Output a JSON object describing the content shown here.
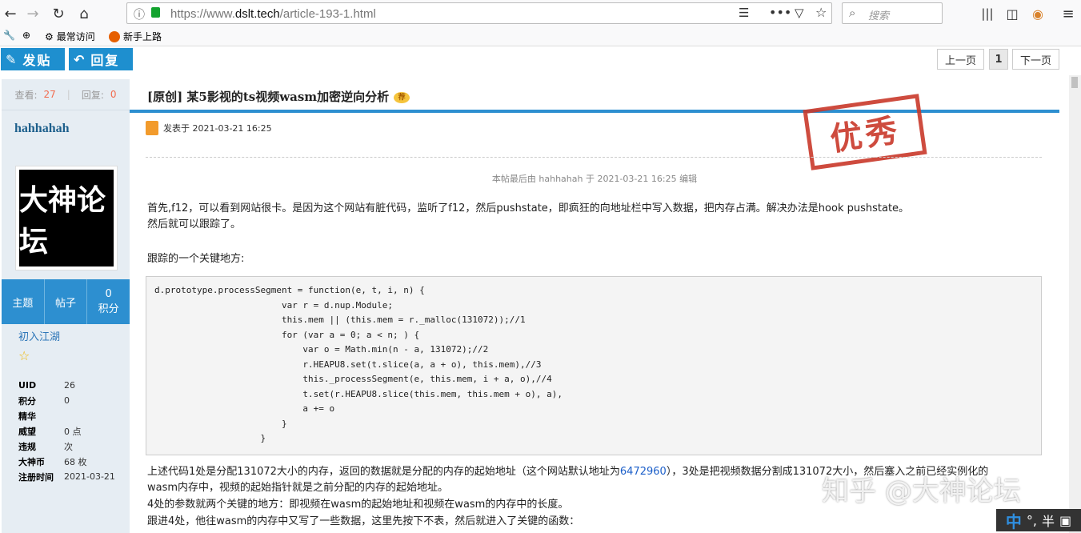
{
  "browser": {
    "url_prefix": "https://www.",
    "url_host": "dslt.tech",
    "url_path": "/article-193-1.html",
    "search_placeholder": "搜索",
    "bookmarks": [
      "最常访问",
      "新手上路"
    ]
  },
  "actions": {
    "post_label": "发贴",
    "reply_label": "回复"
  },
  "pager": {
    "prev": "上一页",
    "current": "1",
    "next": "下一页"
  },
  "sidebar": {
    "views_label": "查看:",
    "views_value": "27",
    "replies_label": "回复:",
    "replies_value": "0",
    "author": "hahhahah",
    "avatar_text": "大神论坛",
    "stat_cells": [
      "主题",
      "帖子",
      "0",
      "积分"
    ],
    "level": "初入江湖",
    "info": [
      {
        "k": "UID",
        "v": "26"
      },
      {
        "k": "积分",
        "v": "0"
      },
      {
        "k": "精华",
        "v": ""
      },
      {
        "k": "威望",
        "v": "0 点"
      },
      {
        "k": "违规",
        "v": "次"
      },
      {
        "k": "大神币",
        "v": "68 枚"
      },
      {
        "k": "注册时间",
        "v": "2021-03-21"
      }
    ]
  },
  "post": {
    "title": "[原创] 某5影视的ts视频wasm加密逆向分析",
    "badge": "荐",
    "posted": "发表于 2021-03-21 16:25",
    "stamp": "优秀",
    "edited": "本帖最后由 hahhahah 于 2021-03-21 16:25 编辑",
    "para1_line1": "首先,f12，可以看到网站很卡。是因为这个网站有脏代码，监听了f12，然后pushstate，即疯狂的向地址栏中写入数据，把内存占满。解决办法是hook pushstate。",
    "para1_line2": "然后就可以跟踪了。",
    "para2": "跟踪的一个关键地方:",
    "code": [
      "d.prototype.processSegment = function(e, t, i, n) {",
      "                        var r = d.nup.Module;",
      "                        this.mem || (this.mem = r._malloc(131072));//1",
      "                        for (var a = 0; a < n; ) {",
      "                            var o = Math.min(n - a, 131072);//2",
      "                            r.HEAPU8.set(t.slice(a, a + o), this.mem),//3",
      "                            this._processSegment(e, this.mem, i + a, o),//4",
      "                            t.set(r.HEAPU8.slice(this.mem, this.mem + o), a),",
      "                            a += o",
      "                        }",
      "                    }"
    ],
    "para3_pre": "上述代码1处是分配131072大小的内存，返回的数据就是分配的内存的起始地址（这个网站默认地址为",
    "para3_num": "6472960",
    "para3_post": "），3处是把视频数据分割成131072大小，然后塞入之前已经实例化的",
    "para3_line2": "wasm内存中，视频的起始指针就是之前分配的内存的起始地址。",
    "para4": "4处的参数就两个关键的地方：即视频在wasm的起始地址和视频在wasm的内存中的长度。",
    "para5": "跟进4处，他往wasm的内存中又写了一些数据，这里先按下不表，然后就进入了关键的函数："
  },
  "watermark": "知乎 @大神论坛",
  "ime": {
    "mode": "中",
    "punct": "°,",
    "width": "半"
  }
}
